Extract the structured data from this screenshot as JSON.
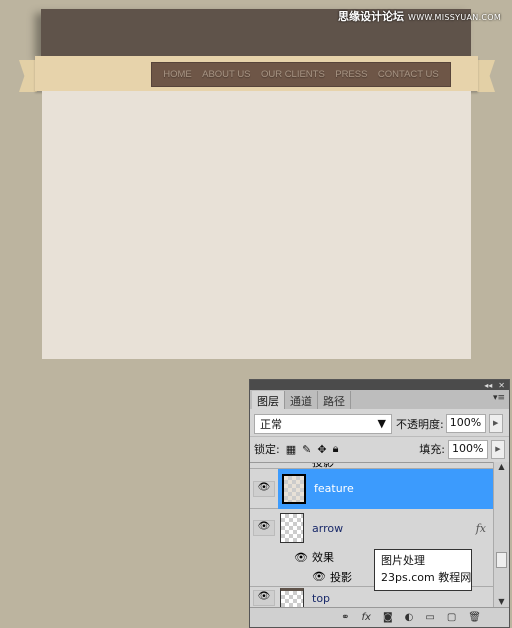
{
  "watermark": {
    "brand": "思缘设计论坛",
    "url": "WWW.MISSYUAN.COM"
  },
  "nav": {
    "items": [
      "HOME",
      "ABOUT US",
      "OUR CLIENTS",
      "PRESS",
      "CONTACT US"
    ]
  },
  "panel": {
    "tabs": [
      "图层",
      "通道",
      "路径"
    ],
    "blend_mode": "正常",
    "opacity_label": "不透明度:",
    "opacity": "100%",
    "lock_label": "锁定:",
    "fill_label": "填充:",
    "fill": "100%",
    "layers": [
      {
        "name": "投影",
        "partial": true
      },
      {
        "name": "feature",
        "selected": true
      },
      {
        "name": "arrow",
        "fx": "fx"
      },
      {
        "name": "效果"
      },
      {
        "name": "投影"
      },
      {
        "name": "top"
      }
    ],
    "watermark": {
      "line1": "图片处理",
      "line2": "23ps.com 教程网"
    },
    "selection_color": "#3c9bfd"
  }
}
